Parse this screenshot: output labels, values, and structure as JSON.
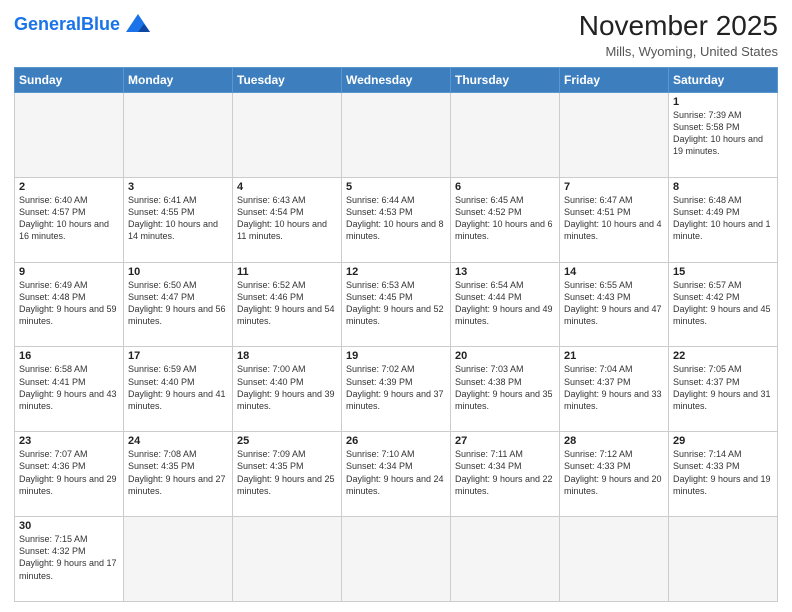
{
  "logo": {
    "text_general": "General",
    "text_blue": "Blue"
  },
  "title": "November 2025",
  "subtitle": "Mills, Wyoming, United States",
  "weekdays": [
    "Sunday",
    "Monday",
    "Tuesday",
    "Wednesday",
    "Thursday",
    "Friday",
    "Saturday"
  ],
  "weeks": [
    [
      {
        "day": "",
        "info": ""
      },
      {
        "day": "",
        "info": ""
      },
      {
        "day": "",
        "info": ""
      },
      {
        "day": "",
        "info": ""
      },
      {
        "day": "",
        "info": ""
      },
      {
        "day": "",
        "info": ""
      },
      {
        "day": "1",
        "info": "Sunrise: 7:39 AM\nSunset: 5:58 PM\nDaylight: 10 hours and 19 minutes."
      }
    ],
    [
      {
        "day": "2",
        "info": "Sunrise: 6:40 AM\nSunset: 4:57 PM\nDaylight: 10 hours and 16 minutes."
      },
      {
        "day": "3",
        "info": "Sunrise: 6:41 AM\nSunset: 4:55 PM\nDaylight: 10 hours and 14 minutes."
      },
      {
        "day": "4",
        "info": "Sunrise: 6:43 AM\nSunset: 4:54 PM\nDaylight: 10 hours and 11 minutes."
      },
      {
        "day": "5",
        "info": "Sunrise: 6:44 AM\nSunset: 4:53 PM\nDaylight: 10 hours and 8 minutes."
      },
      {
        "day": "6",
        "info": "Sunrise: 6:45 AM\nSunset: 4:52 PM\nDaylight: 10 hours and 6 minutes."
      },
      {
        "day": "7",
        "info": "Sunrise: 6:47 AM\nSunset: 4:51 PM\nDaylight: 10 hours and 4 minutes."
      },
      {
        "day": "8",
        "info": "Sunrise: 6:48 AM\nSunset: 4:49 PM\nDaylight: 10 hours and 1 minute."
      }
    ],
    [
      {
        "day": "9",
        "info": "Sunrise: 6:49 AM\nSunset: 4:48 PM\nDaylight: 9 hours and 59 minutes."
      },
      {
        "day": "10",
        "info": "Sunrise: 6:50 AM\nSunset: 4:47 PM\nDaylight: 9 hours and 56 minutes."
      },
      {
        "day": "11",
        "info": "Sunrise: 6:52 AM\nSunset: 4:46 PM\nDaylight: 9 hours and 54 minutes."
      },
      {
        "day": "12",
        "info": "Sunrise: 6:53 AM\nSunset: 4:45 PM\nDaylight: 9 hours and 52 minutes."
      },
      {
        "day": "13",
        "info": "Sunrise: 6:54 AM\nSunset: 4:44 PM\nDaylight: 9 hours and 49 minutes."
      },
      {
        "day": "14",
        "info": "Sunrise: 6:55 AM\nSunset: 4:43 PM\nDaylight: 9 hours and 47 minutes."
      },
      {
        "day": "15",
        "info": "Sunrise: 6:57 AM\nSunset: 4:42 PM\nDaylight: 9 hours and 45 minutes."
      }
    ],
    [
      {
        "day": "16",
        "info": "Sunrise: 6:58 AM\nSunset: 4:41 PM\nDaylight: 9 hours and 43 minutes."
      },
      {
        "day": "17",
        "info": "Sunrise: 6:59 AM\nSunset: 4:40 PM\nDaylight: 9 hours and 41 minutes."
      },
      {
        "day": "18",
        "info": "Sunrise: 7:00 AM\nSunset: 4:40 PM\nDaylight: 9 hours and 39 minutes."
      },
      {
        "day": "19",
        "info": "Sunrise: 7:02 AM\nSunset: 4:39 PM\nDaylight: 9 hours and 37 minutes."
      },
      {
        "day": "20",
        "info": "Sunrise: 7:03 AM\nSunset: 4:38 PM\nDaylight: 9 hours and 35 minutes."
      },
      {
        "day": "21",
        "info": "Sunrise: 7:04 AM\nSunset: 4:37 PM\nDaylight: 9 hours and 33 minutes."
      },
      {
        "day": "22",
        "info": "Sunrise: 7:05 AM\nSunset: 4:37 PM\nDaylight: 9 hours and 31 minutes."
      }
    ],
    [
      {
        "day": "23",
        "info": "Sunrise: 7:07 AM\nSunset: 4:36 PM\nDaylight: 9 hours and 29 minutes."
      },
      {
        "day": "24",
        "info": "Sunrise: 7:08 AM\nSunset: 4:35 PM\nDaylight: 9 hours and 27 minutes."
      },
      {
        "day": "25",
        "info": "Sunrise: 7:09 AM\nSunset: 4:35 PM\nDaylight: 9 hours and 25 minutes."
      },
      {
        "day": "26",
        "info": "Sunrise: 7:10 AM\nSunset: 4:34 PM\nDaylight: 9 hours and 24 minutes."
      },
      {
        "day": "27",
        "info": "Sunrise: 7:11 AM\nSunset: 4:34 PM\nDaylight: 9 hours and 22 minutes."
      },
      {
        "day": "28",
        "info": "Sunrise: 7:12 AM\nSunset: 4:33 PM\nDaylight: 9 hours and 20 minutes."
      },
      {
        "day": "29",
        "info": "Sunrise: 7:14 AM\nSunset: 4:33 PM\nDaylight: 9 hours and 19 minutes."
      }
    ],
    [
      {
        "day": "30",
        "info": "Sunrise: 7:15 AM\nSunset: 4:32 PM\nDaylight: 9 hours and 17 minutes."
      },
      {
        "day": "",
        "info": ""
      },
      {
        "day": "",
        "info": ""
      },
      {
        "day": "",
        "info": ""
      },
      {
        "day": "",
        "info": ""
      },
      {
        "day": "",
        "info": ""
      },
      {
        "day": "",
        "info": ""
      }
    ]
  ]
}
